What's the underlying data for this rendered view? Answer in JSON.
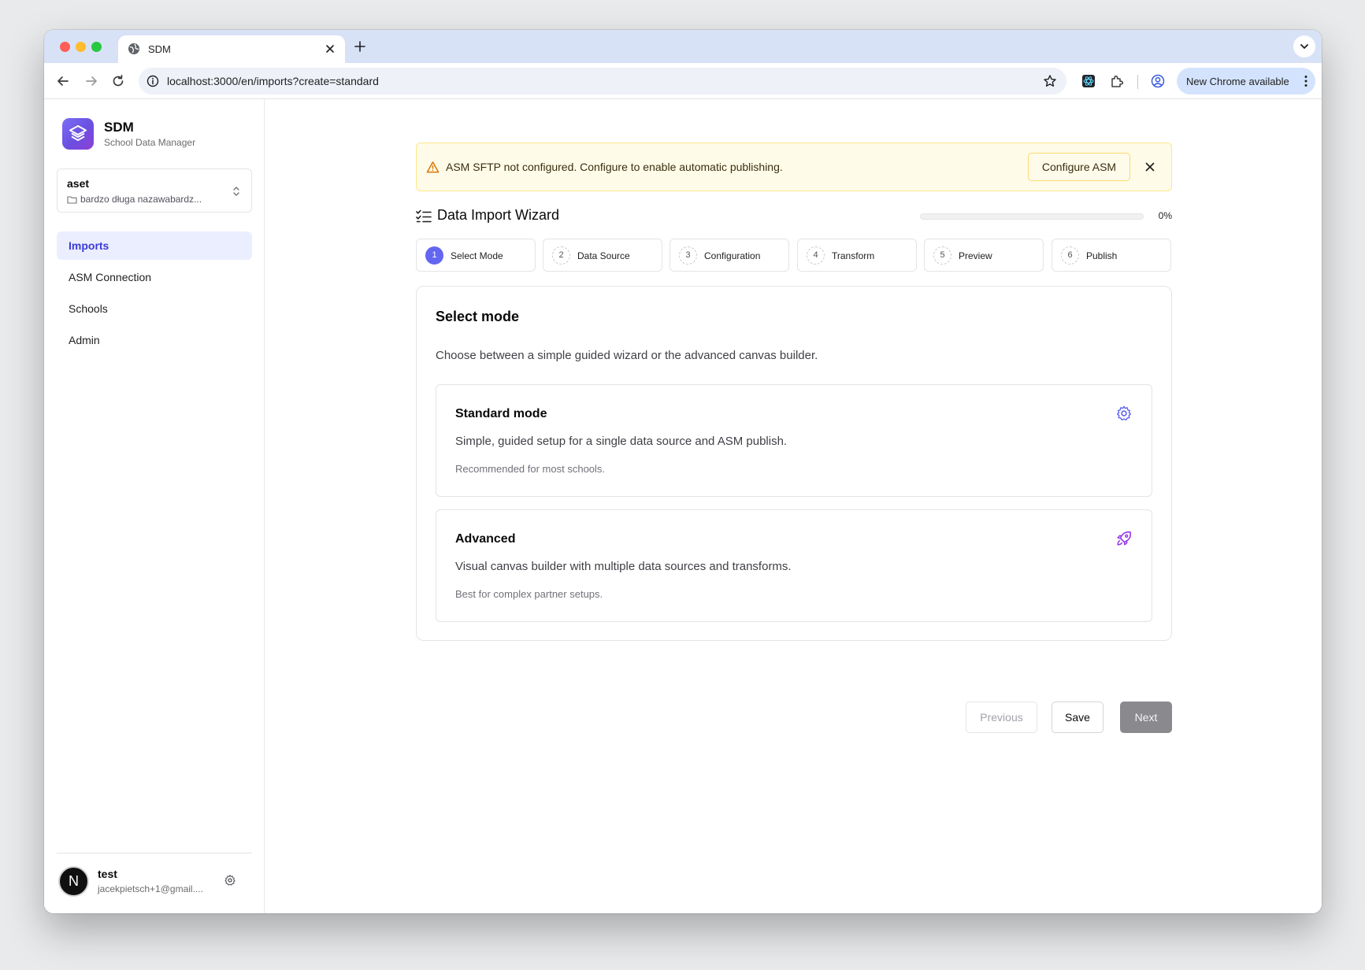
{
  "browser": {
    "tab_title": "SDM",
    "url": "localhost:3000/en/imports?create=standard",
    "update_label": "New Chrome available"
  },
  "sidebar": {
    "brand_name": "SDM",
    "brand_subtitle": "School Data Manager",
    "org": {
      "name": "aset",
      "path": "bardzo długa nazawabardz..."
    },
    "items": [
      {
        "label": "Imports",
        "active": true
      },
      {
        "label": "ASM Connection",
        "active": false
      },
      {
        "label": "Schools",
        "active": false
      },
      {
        "label": "Admin",
        "active": false
      }
    ],
    "user": {
      "avatar_initial": "N",
      "name": "test",
      "email": "jacekpietsch+1@gmail...."
    }
  },
  "alert": {
    "message": "ASM SFTP not configured. Configure to enable automatic publishing.",
    "button_label": "Configure ASM"
  },
  "wizard": {
    "title": "Data Import Wizard",
    "progress_percent": 0,
    "progress_label": "0%",
    "steps": [
      {
        "number": "1",
        "label": "Select Mode",
        "active": true
      },
      {
        "number": "2",
        "label": "Data Source",
        "active": false
      },
      {
        "number": "3",
        "label": "Configuration",
        "active": false
      },
      {
        "number": "4",
        "label": "Transform",
        "active": false
      },
      {
        "number": "5",
        "label": "Preview",
        "active": false
      },
      {
        "number": "6",
        "label": "Publish",
        "active": false
      }
    ],
    "mode": {
      "title": "Select mode",
      "description": "Choose between a simple guided wizard or the advanced canvas builder.",
      "options": [
        {
          "title": "Standard mode",
          "description": "Simple, guided setup for a single data source and ASM publish.",
          "note": "Recommended for most schools.",
          "icon": "gear-icon"
        },
        {
          "title": "Advanced",
          "description": "Visual canvas builder with multiple data sources and transforms.",
          "note": "Best for complex partner setups.",
          "icon": "rocket-icon"
        }
      ]
    },
    "buttons": {
      "previous": "Previous",
      "save": "Save",
      "next": "Next"
    }
  },
  "colors": {
    "accent": "#6366f1",
    "alert_bg": "#fefce8",
    "active_nav_bg": "#ebeefe",
    "active_nav_text": "#3b3bd9"
  }
}
